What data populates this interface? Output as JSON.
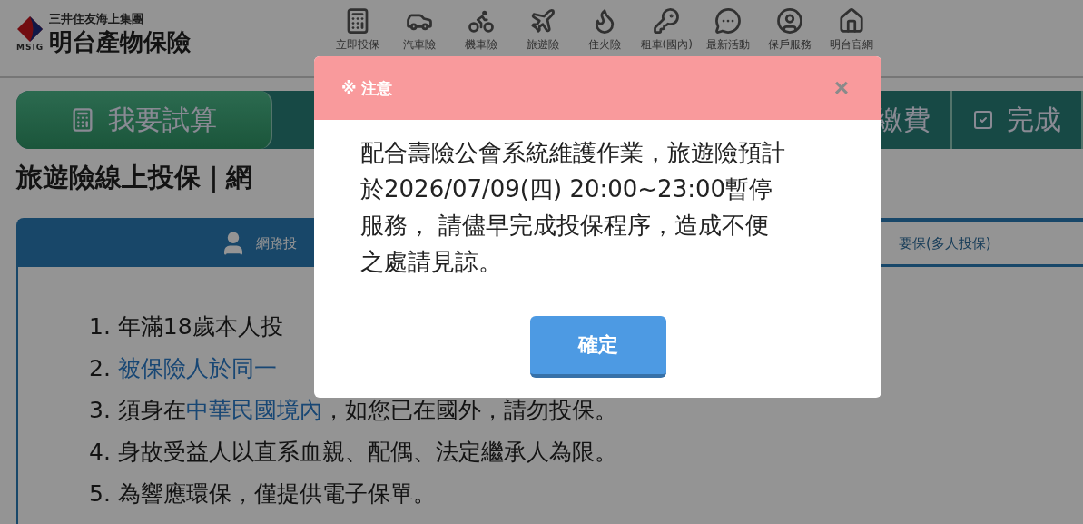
{
  "header": {
    "logo_caption": "MSIG",
    "group_name": "三井住友海上集團",
    "company_name": "明台產物保險",
    "nav": [
      {
        "label": "立即投保"
      },
      {
        "label": "汽車險"
      },
      {
        "label": "機車險"
      },
      {
        "label": "旅遊險"
      },
      {
        "label": "住火險"
      },
      {
        "label": "租車(國內)"
      },
      {
        "label": "最新活動"
      },
      {
        "label": "保戶服務"
      },
      {
        "label": "明台官網"
      }
    ]
  },
  "steps": [
    {
      "label": "我要試算",
      "selected": true
    },
    {
      "label": "繳費",
      "selected": false
    },
    {
      "label": "完成",
      "selected": false
    }
  ],
  "page_title": "旅遊險線上投保｜網",
  "tabs": [
    {
      "label": "網路投",
      "selected": true
    },
    {
      "label": "要保(多人投保)",
      "selected": false
    }
  ],
  "notes": [
    {
      "number": "1.",
      "parts": [
        {
          "text": "年滿18歲本人投",
          "link": false
        }
      ]
    },
    {
      "number": "2.",
      "parts": [
        {
          "text": "被保險人於同一",
          "link": true
        }
      ]
    },
    {
      "number": "3.",
      "parts": [
        {
          "text": "須身在",
          "link": false
        },
        {
          "text": "中華民國境內",
          "link": true
        },
        {
          "text": "，如您已在國外，請勿投保。",
          "link": false
        }
      ]
    },
    {
      "number": "4.",
      "parts": [
        {
          "text": "身故受益人以直系血親、配偶、法定繼承人為限。",
          "link": false
        }
      ]
    },
    {
      "number": "5.",
      "parts": [
        {
          "text": "為響應環保，僅提供電子保單。",
          "link": false
        }
      ]
    }
  ],
  "dialog": {
    "title": "※ 注意",
    "close": "×",
    "message": "配合壽險公會系統維護作業，旅遊險預計於2026/07/09(四) 20:00~23:00暫停服務， 請儘早完成投保程序，造成不便之處請見諒。",
    "button": "確定"
  }
}
